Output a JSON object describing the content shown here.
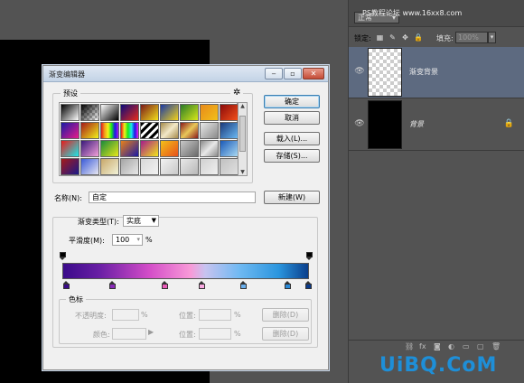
{
  "layers_panel": {
    "blend_mode": "正常",
    "lock_label": "锁定:",
    "fill_label": "填充:",
    "fill_value": "100%",
    "layers": [
      {
        "name": "渐变背景",
        "selected": true,
        "thumb": "transparent"
      },
      {
        "name": "背景",
        "selected": false,
        "thumb": "black",
        "locked": true
      }
    ],
    "top_text": "PS教程论坛 www.16xx8.com"
  },
  "watermark": "UiBQ.CoM",
  "dialog": {
    "title": "渐变编辑器",
    "presets_label": "预设",
    "buttons": {
      "ok": "确定",
      "cancel": "取消",
      "load": "载入(L)...",
      "save": "存储(S)...",
      "new": "新建(W)",
      "delete1": "删除(D)",
      "delete2": "删除(D)"
    },
    "name_label": "名称(N):",
    "name_value": "自定",
    "gradient_type_label": "渐变类型(T):",
    "gradient_type_value": "实底",
    "smoothness_label": "平滑度(M):",
    "smoothness_value": "100",
    "smoothness_unit": "%",
    "stops_label": "色标",
    "opacity_label": "不透明度:",
    "location_label1": "位置:",
    "percent1": "%",
    "percent2": "%",
    "percent3": "%",
    "color_label": "颜色:",
    "location_label2": "位置:",
    "gear_icon": "gear-icon",
    "preset_swatches": [
      "linear-gradient(135deg,#000,#fff)",
      "linear-gradient(135deg,#000 0%,transparent 100%),repeating-conic-gradient(#bbb 0 25%,#fff 0 50%) 0 0/6px 6px",
      "linear-gradient(135deg,#fff,#000)",
      "linear-gradient(135deg,#0a0a7a,#e82a1a)",
      "linear-gradient(135deg,#7a1a1a,#f2e01a)",
      "linear-gradient(135deg,#1a3aa5,#f2d21a)",
      "linear-gradient(135deg,#2a7a2a,#d8e81a)",
      "linear-gradient(135deg,#e88a1a,#f2c01a)",
      "linear-gradient(135deg,#8a0a0a,#f2501a)",
      "linear-gradient(135deg,#1a1aa5,#e81a8a)",
      "linear-gradient(135deg,#a51a1a,#f2f21a)",
      "linear-gradient(90deg,#e81a1a,#f2a01a,#f2f21a,#1ae81a,#1a1ae8,#a51ae8)",
      "linear-gradient(90deg,#e81a1a,#f2f21a,#1ae81a,#1ae8e8,#1a1ae8,#e81ae8)",
      "repeating-linear-gradient(135deg,#000 0 3px,#fff 3px 6px)",
      "linear-gradient(135deg,#a58a4a,#f2e8c8,#a58a4a)",
      "linear-gradient(135deg,#8a1a1a,#e8c85a,#8a1a1a)",
      "linear-gradient(135deg,#e8e8e8,#8a8a8a)",
      "linear-gradient(135deg,#1a3a7a,#6ab8f2)",
      "linear-gradient(135deg,#e81a1a,#1ae8e8)",
      "linear-gradient(135deg,#3a1a7a,#f2a0d8)",
      "linear-gradient(135deg,#1a8a3a,#e8e81a)",
      "linear-gradient(135deg,#e8801a,#1a1aa5)",
      "linear-gradient(135deg,#a51a8a,#f2e81a)",
      "linear-gradient(135deg,#f2c01a,#e8501a)",
      "linear-gradient(135deg,#c8c8c8,#6a6a6a)",
      "linear-gradient(135deg,#8a8a8a,#e8e8e8,#8a8a8a)",
      "linear-gradient(135deg,#1a5ab8,#a8d8f2)",
      "linear-gradient(135deg,#a51a1a,#1a1a8a)",
      "linear-gradient(135deg,#3a5ad8,#e8e8f2)",
      "linear-gradient(135deg,#c8a86a,#f2f2d8)",
      "linear-gradient(135deg,#a5a5a5,#e8e8e8)",
      "linear-gradient(135deg,#d8d8d8,#f2f2f2)",
      "linear-gradient(135deg,#f2f2f2,#c8c8c8)",
      "linear-gradient(135deg,#e8e8e8,#b8b8b8)",
      "linear-gradient(135deg,#d0d0d0,#f0f0f0)",
      "linear-gradient(135deg,#c0c0c0,#e0e0e0)"
    ],
    "gradient_stop_colors": [
      "#3a0a8a",
      "#8a2ab8",
      "#e85ab8",
      "#f8a8e0",
      "#6ab0ee",
      "#2a8ad8",
      "#0a3a8a"
    ]
  }
}
